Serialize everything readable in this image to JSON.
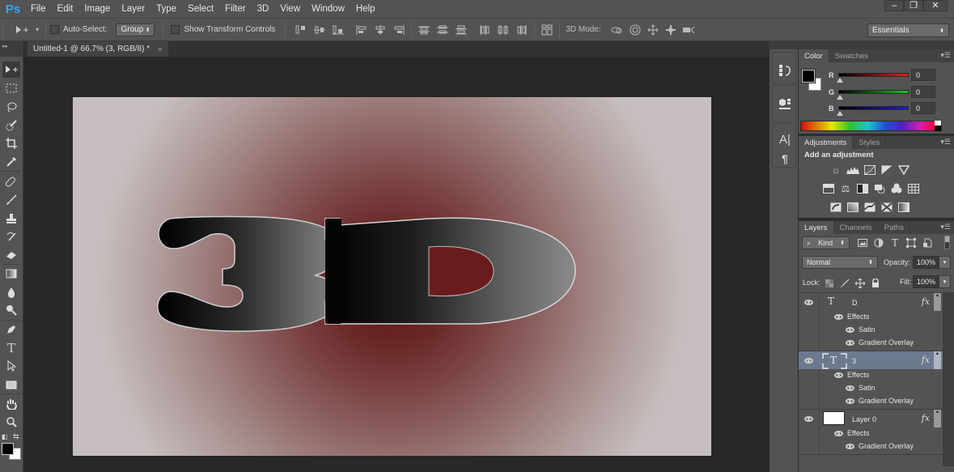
{
  "app": {
    "logo": "Ps",
    "menu": [
      "File",
      "Edit",
      "Image",
      "Layer",
      "Type",
      "Select",
      "Filter",
      "3D",
      "View",
      "Window",
      "Help"
    ],
    "window_controls": {
      "minimize": "–",
      "restore": "❐",
      "close": "✕"
    }
  },
  "options_bar": {
    "auto_select_label": "Auto-Select:",
    "auto_select_checked": false,
    "auto_select_target": "Group",
    "show_transform_label": "Show Transform Controls",
    "show_transform_checked": false,
    "align_icons": [
      "align-top-edges-icon",
      "align-vertical-centers-icon",
      "align-bottom-edges-icon",
      "align-left-edges-icon",
      "align-horizontal-centers-icon",
      "align-right-edges-icon"
    ],
    "distribute_icons": [
      "distribute-top-icon",
      "distribute-vertical-centers-icon",
      "distribute-bottom-icon",
      "distribute-left-icon",
      "distribute-horizontal-centers-icon",
      "distribute-right-icon"
    ],
    "auto_align_icon": "auto-align-layers-icon",
    "mode_label": "3D Mode:",
    "mode_icons": [
      "3d-orbit-icon",
      "3d-roll-icon",
      "3d-drag-icon",
      "3d-slide-icon",
      "3d-scale-icon"
    ],
    "workspace": "Essentials"
  },
  "document": {
    "tab_title": "Untitled-1 @ 66.7% (3, RGB/8) *",
    "tab_close": "×",
    "canvas_text": "3D"
  },
  "tools": [
    "move-tool",
    "marquee-tool",
    "lasso-tool",
    "quick-selection-tool",
    "crop-tool",
    "eyedropper-tool",
    "spot-healing-tool",
    "brush-tool",
    "clone-stamp-tool",
    "history-brush-tool",
    "eraser-tool",
    "gradient-tool",
    "blur-tool",
    "dodge-tool",
    "pen-tool",
    "type-tool",
    "path-selection-tool",
    "rectangle-tool",
    "hand-tool",
    "zoom-tool"
  ],
  "colors": {
    "foreground": "#000000",
    "background": "#ffffff",
    "accent_selected_layer": "#6c7a8f"
  },
  "color_panel": {
    "tabs": [
      "Color",
      "Swatches"
    ],
    "active_tab": "Color",
    "channels": [
      {
        "label": "R",
        "value": "0",
        "color": "#e02020"
      },
      {
        "label": "G",
        "value": "0",
        "color": "#20c020"
      },
      {
        "label": "B",
        "value": "0",
        "color": "#2020d0"
      }
    ]
  },
  "adjustments_panel": {
    "tabs": [
      "Adjustments",
      "Styles"
    ],
    "active_tab": "Adjustments",
    "heading": "Add an adjustment",
    "rows": [
      [
        "brightness-contrast-icon",
        "levels-icon",
        "curves-icon",
        "exposure-icon",
        "vibrance-icon"
      ],
      [
        "hue-saturation-icon",
        "color-balance-icon",
        "black-white-icon",
        "photo-filter-icon",
        "channel-mixer-icon",
        "color-lookup-icon"
      ],
      [
        "invert-icon",
        "posterize-icon",
        "threshold-icon",
        "selective-color-icon",
        "gradient-map-icon"
      ]
    ]
  },
  "layers_panel": {
    "tabs": [
      "Layers",
      "Channels",
      "Paths"
    ],
    "active_tab": "Layers",
    "filter_kind": "Kind",
    "blend_mode": "Normal",
    "opacity_label": "Opacity:",
    "opacity": "100%",
    "lock_label": "Lock:",
    "fill_label": "Fill:",
    "fill": "100%",
    "layers": [
      {
        "name": "D",
        "type": "text",
        "selected": false,
        "fx": "fx",
        "effects_label": "Effects",
        "effects": [
          "Satin",
          "Gradient Overlay"
        ]
      },
      {
        "name": "3",
        "type": "text",
        "selected": true,
        "fx": "fx",
        "effects_label": "Effects",
        "effects": [
          "Satin",
          "Gradient Overlay"
        ]
      },
      {
        "name": "Layer 0",
        "type": "pixel",
        "selected": false,
        "fx": "fx",
        "effects_label": "Effects",
        "effects": [
          "Gradient Overlay"
        ]
      }
    ]
  }
}
